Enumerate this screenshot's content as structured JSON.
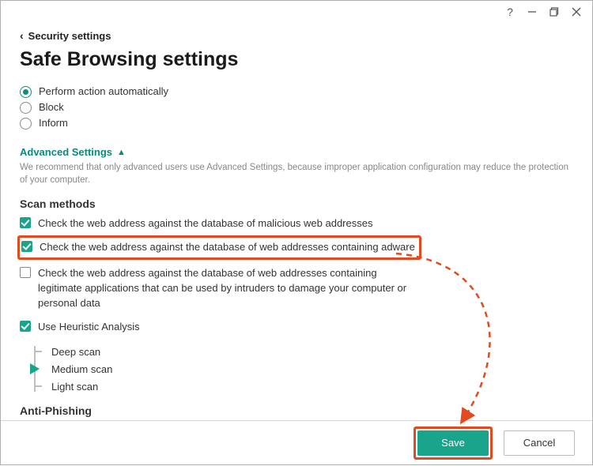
{
  "titlebar": {
    "help": "?",
    "minimize": "—",
    "maximize": "❐",
    "close": "✕"
  },
  "breadcrumb": {
    "back_label": "Security settings"
  },
  "page_title": "Safe Browsing settings",
  "action_radios": {
    "auto": "Perform action automatically",
    "block": "Block",
    "inform": "Inform"
  },
  "advanced": {
    "toggle_label": "Advanced Settings",
    "note": "We recommend that only advanced users use Advanced Settings, because improper application configuration may reduce the protection of your computer."
  },
  "scan_methods": {
    "heading": "Scan methods",
    "malicious": "Check the web address against the database of malicious web addresses",
    "adware": "Check the web address against the database of web addresses containing adware",
    "legitimate": "Check the web address against the database of web addresses containing legitimate applications that can be used by intruders to damage your computer or personal data",
    "heuristic": "Use Heuristic Analysis",
    "levels": {
      "deep": "Deep scan",
      "medium": "Medium scan",
      "light": "Light scan"
    }
  },
  "anti_phishing_heading": "Anti-Phishing",
  "footer": {
    "save": "Save",
    "cancel": "Cancel"
  },
  "colors": {
    "accent": "#18a58c",
    "highlight": "#e44a1f"
  }
}
